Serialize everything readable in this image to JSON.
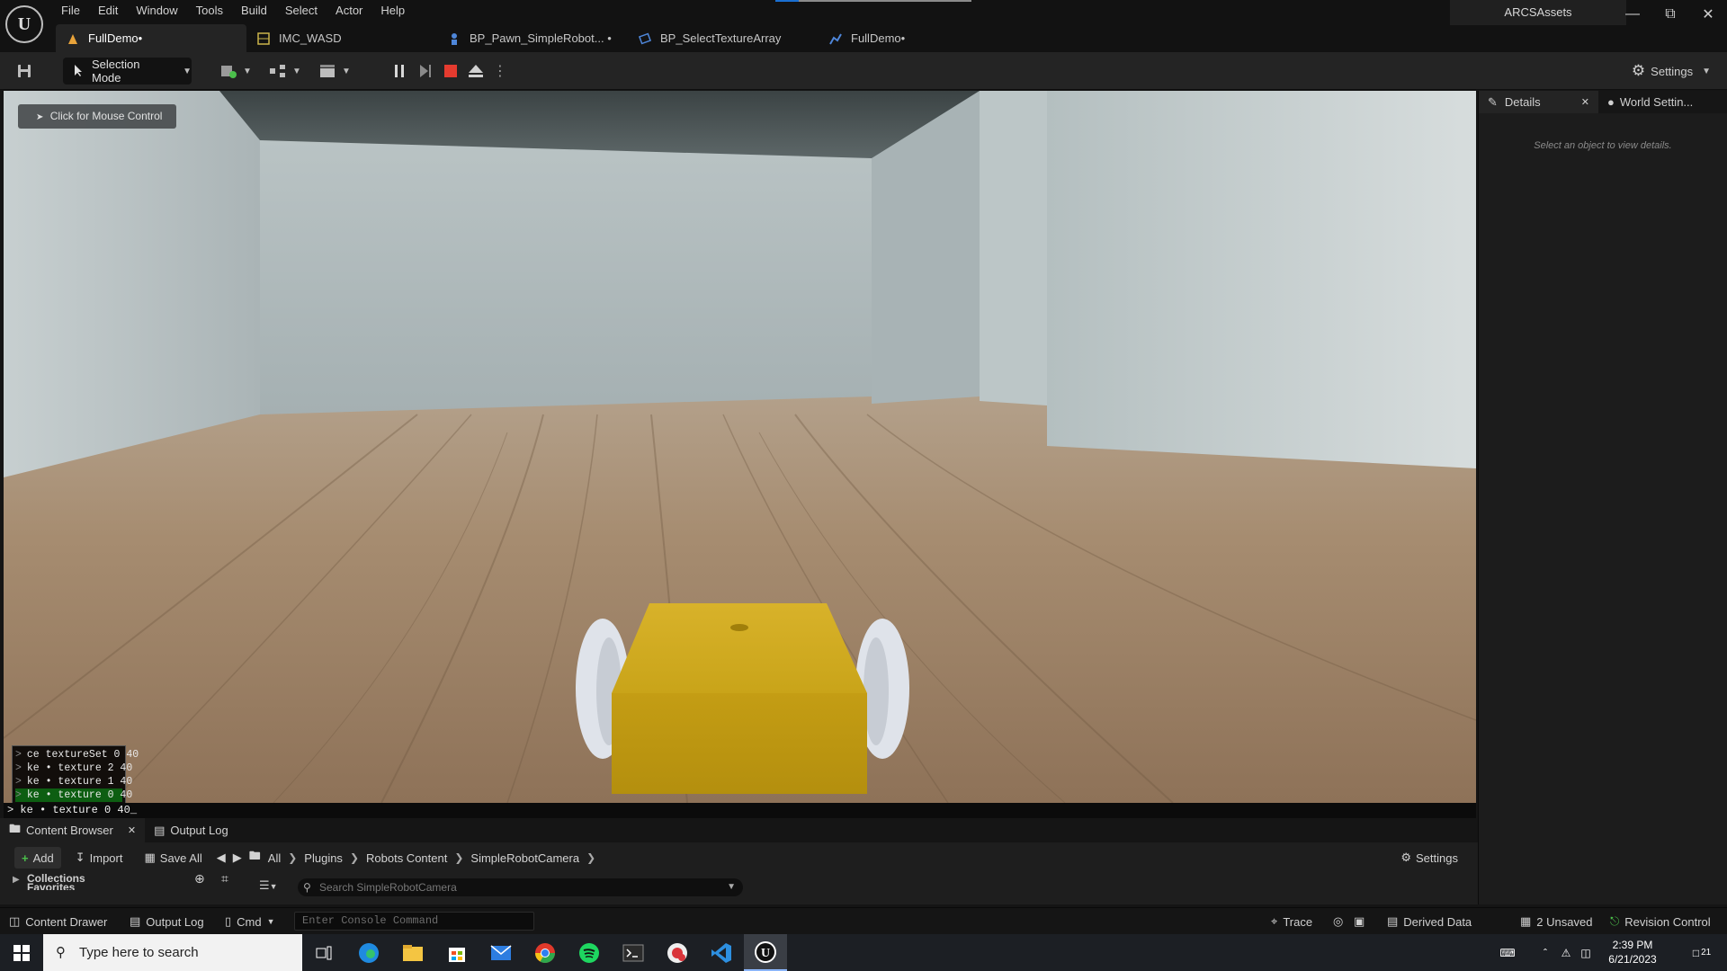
{
  "app": {
    "menu": [
      "File",
      "Edit",
      "Window",
      "Tools",
      "Build",
      "Select",
      "Actor",
      "Help"
    ],
    "project": "ARCSAssets"
  },
  "tabs": [
    {
      "label": "FullDemo•",
      "icon": "level-icon"
    },
    {
      "label": "IMC_WASD",
      "icon": "input-mapping-icon"
    },
    {
      "label": "BP_Pawn_SimpleRobot... •",
      "icon": "pawn-blueprint-icon"
    },
    {
      "label": "BP_SelectTextureArray",
      "icon": "blueprint-icon"
    },
    {
      "label": "FullDemo•",
      "icon": "level-sequence-icon"
    }
  ],
  "toolbar": {
    "selection_mode": "Selection Mode",
    "settings": "Settings"
  },
  "viewport": {
    "mouse_hint": "Click for Mouse Control",
    "console_history": [
      "ce textureSet 0 40",
      "ke • texture 2 40",
      "ke • texture 1 40",
      "ke • texture 0  40"
    ],
    "console_line": "> ke • texture 0  40_"
  },
  "details": {
    "tab_details": "Details",
    "tab_world": "World Settin...",
    "empty_text": "Select an object to view details."
  },
  "content_browser": {
    "tab_content": "Content Browser",
    "tab_output": "Output Log",
    "add": "Add",
    "import": "Import",
    "save_all": "Save All",
    "breadcrumbs": [
      "All",
      "Plugins",
      "Robots Content",
      "SimpleRobotCamera"
    ],
    "settings": "Settings",
    "collections": "Collections",
    "favorites": "Favorites",
    "search_placeholder": "Search SimpleRobotCamera"
  },
  "statusbar": {
    "content_drawer": "Content Drawer",
    "output_log": "Output Log",
    "cmd": "Cmd",
    "console_placeholder": "Enter Console Command",
    "trace": "Trace",
    "derived_data": "Derived Data",
    "unsaved": "2 Unsaved",
    "revision_control": "Revision Control"
  },
  "taskbar": {
    "search_placeholder": "Type here to search",
    "time": "2:39 PM",
    "date": "6/21/2023",
    "notifications": "21"
  },
  "colors": {
    "robot_body": "#c9a419",
    "wheel": "#dfe3ea",
    "accent": "#1a6fd1",
    "stop": "#e53b2f"
  }
}
